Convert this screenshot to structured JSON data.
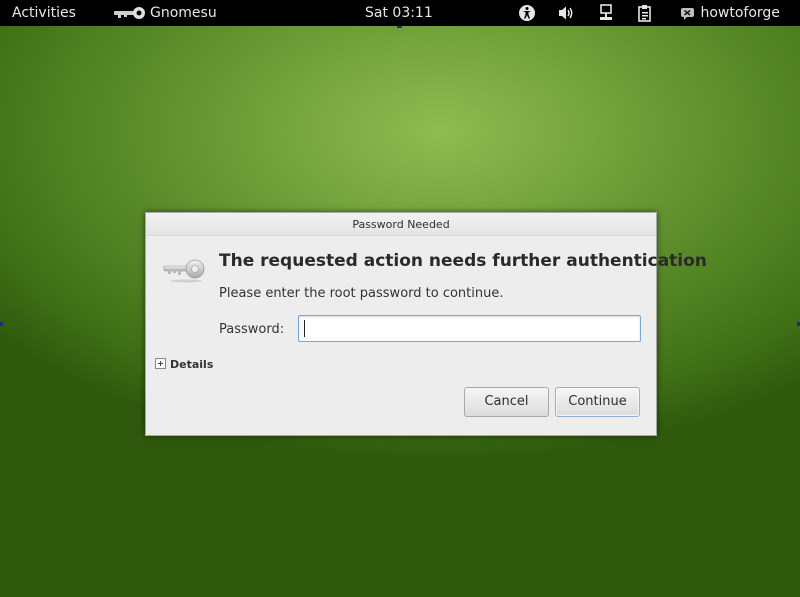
{
  "topbar": {
    "activities_label": "Activities",
    "app_menu_label": "Gnomesu",
    "clock": "Sat 03:11",
    "user_name": "howtoforge",
    "tray_icons": [
      "accessibility-icon",
      "volume-icon",
      "network-icon",
      "clipboard-icon"
    ]
  },
  "dialog": {
    "title": "Password Needed",
    "heading": "The requested action needs further authentication",
    "message": "Please enter the root password to continue.",
    "password_label": "Password:",
    "password_value": "",
    "details_label": "Details",
    "cancel_label": "Cancel",
    "continue_label": "Continue"
  },
  "colors": {
    "topbar_bg": "#000000",
    "desktop_green": "#5b8c2a",
    "dialog_bg": "#ededed",
    "focus_border": "#7aa6d6"
  }
}
